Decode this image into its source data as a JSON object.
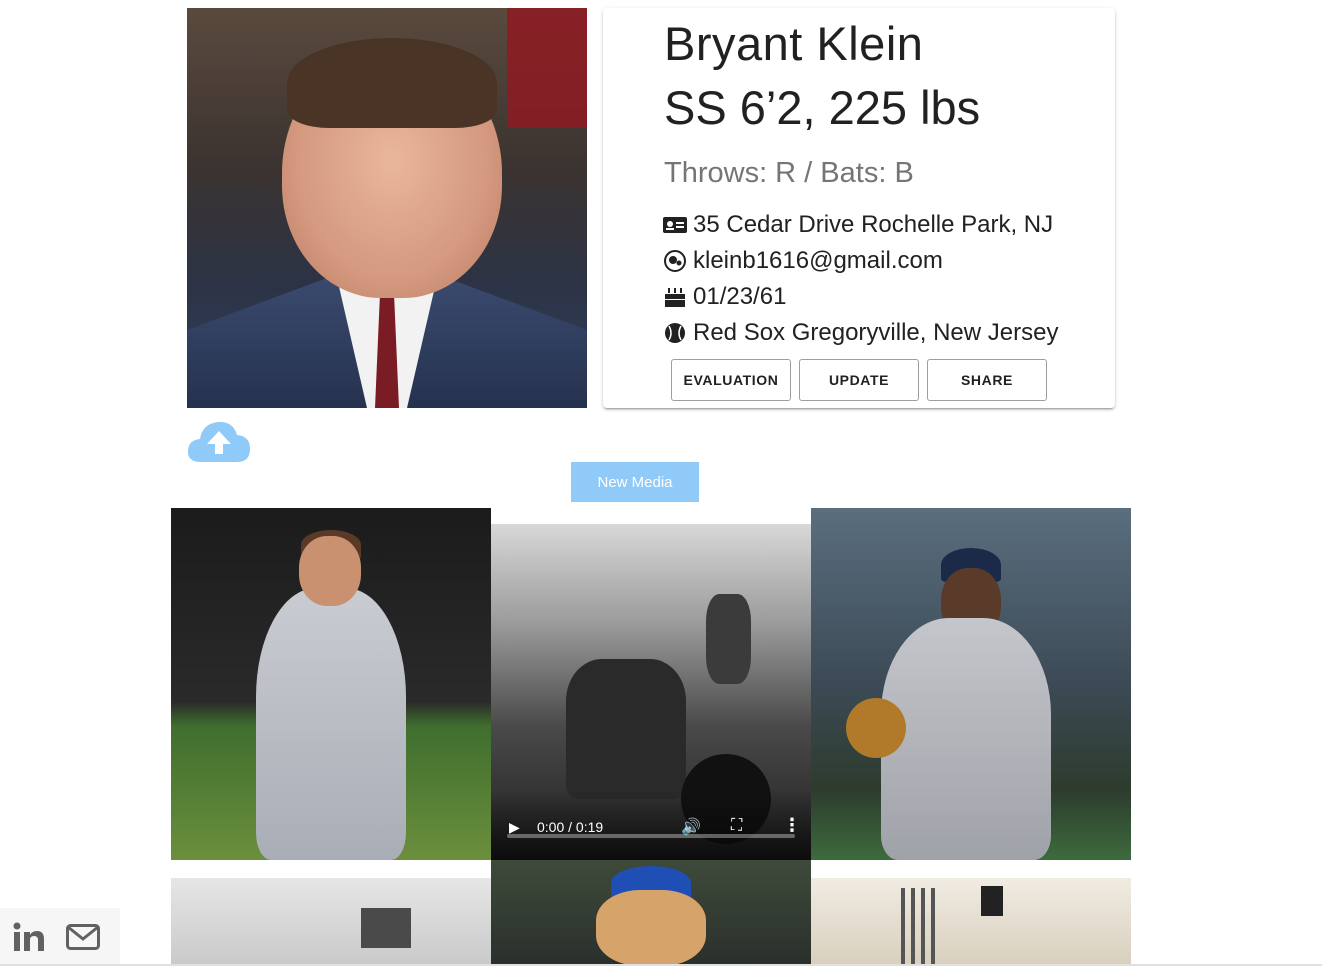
{
  "profile": {
    "name": "Bryant Klein",
    "position_size": "SS 6’2, 225 lbs",
    "throws_bats": "Throws: R / Bats: B",
    "address": "35 Cedar Drive Rochelle Park, NJ",
    "email": "kleinb1616@gmail.com",
    "dob": "01/23/61",
    "team": "Red Sox Gregoryville, New Jersey",
    "icons": {
      "address": "id-card-icon",
      "email": "mailchimp-icon",
      "dob": "birthday-cake-icon",
      "team": "baseball-icon"
    }
  },
  "actions": {
    "evaluation": "EVALUATION",
    "update": "UPDATE",
    "share": "SHARE"
  },
  "media": {
    "upload_icon": "cloud-upload-icon",
    "new_media_label": "New Media",
    "upload_color": "#90caf9",
    "video": {
      "time": "0:00 / 0:19",
      "progress": 0
    }
  },
  "footer": {
    "icons": [
      "linkedin-icon",
      "mail-icon"
    ]
  }
}
